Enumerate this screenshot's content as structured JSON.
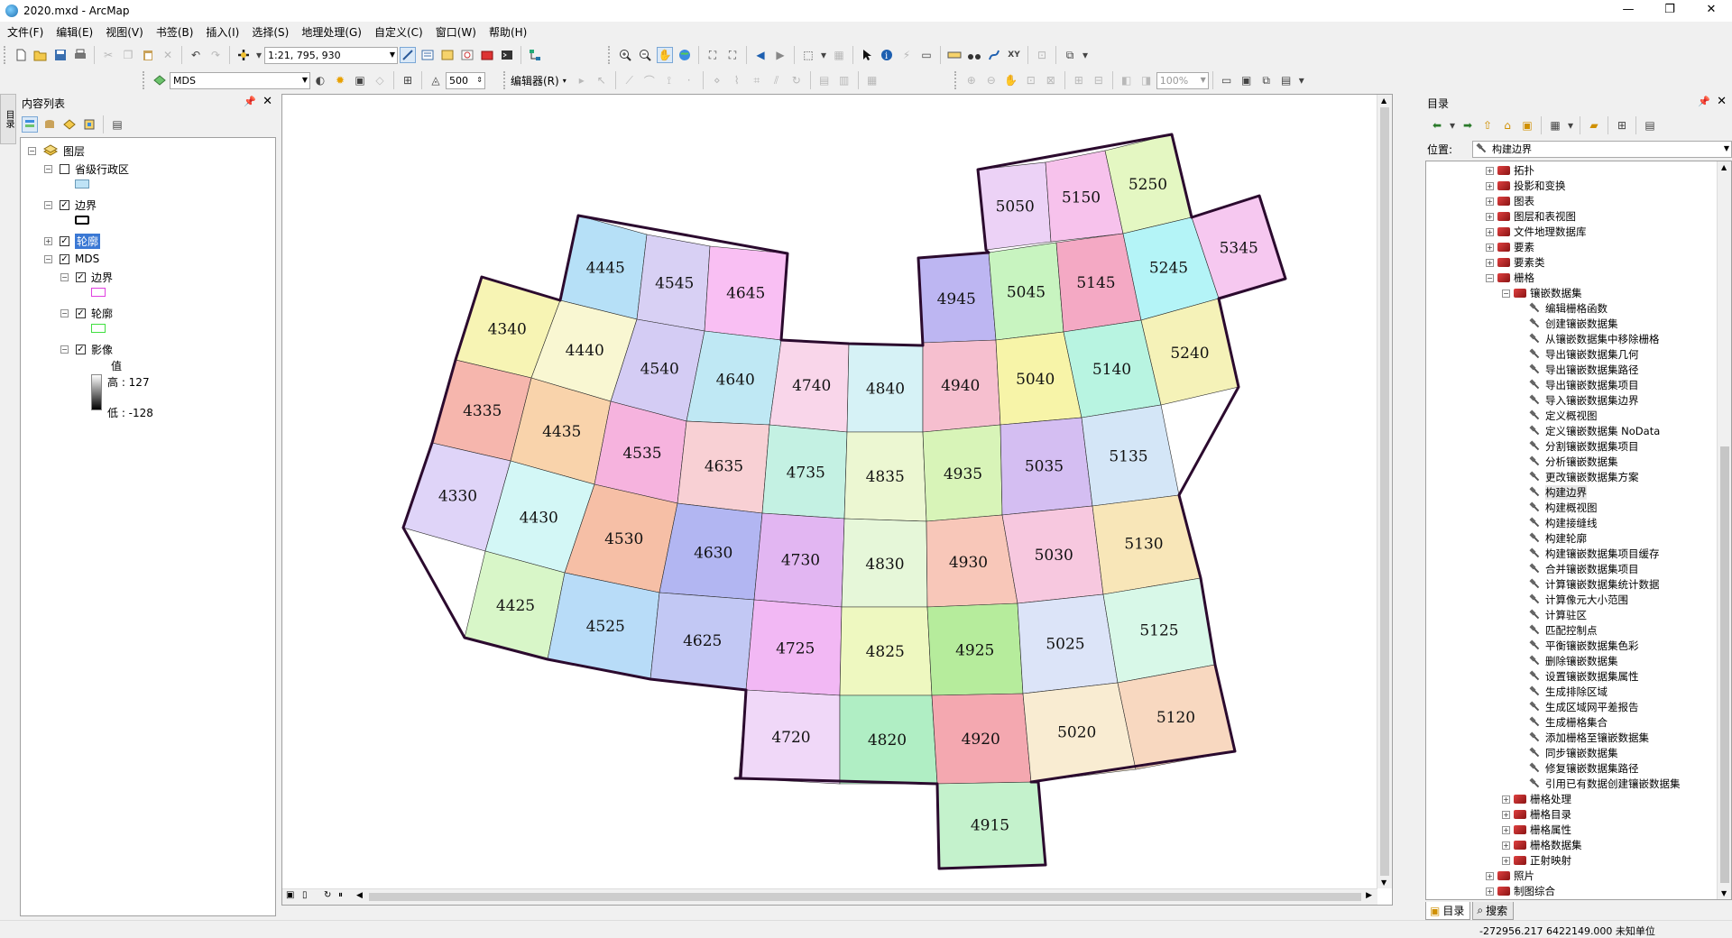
{
  "window": {
    "title": "2020.mxd - ArcMap",
    "min": "—",
    "max": "❐",
    "close": "✕"
  },
  "menu": [
    "文件(F)",
    "编辑(E)",
    "视图(V)",
    "书签(B)",
    "插入(I)",
    "选择(S)",
    "地理处理(G)",
    "自定义(C)",
    "窗口(W)",
    "帮助(H)"
  ],
  "toolbar": {
    "scale": "1:21, 795, 930",
    "layer_combo": "MDS",
    "size_value": "500",
    "editor_label": "编辑器(R)",
    "zoom_percent": "100%"
  },
  "toc": {
    "title": "内容列表",
    "side_tab": "目录",
    "root": "图层",
    "layers": [
      {
        "name": "省级行政区",
        "checked": false
      },
      {
        "name": "边界",
        "checked": true
      },
      {
        "name": "轮廓",
        "checked": true
      },
      {
        "name": "MDS",
        "checked": true
      },
      {
        "name": "边界",
        "checked": true
      },
      {
        "name": "轮廓",
        "checked": true
      },
      {
        "name": "影像",
        "checked": true
      }
    ],
    "legend_value_title": "值",
    "legend_high": "高 : 127",
    "legend_low": "低 : -128",
    "check_mark": "✓"
  },
  "map": {
    "tiles": [
      {
        "label": "5050",
        "color": "#ecd2f6"
      },
      {
        "label": "5150",
        "color": "#f7c2ec"
      },
      {
        "label": "5250",
        "color": "#e4f7c2"
      },
      {
        "label": "5345",
        "color": "#f6c8f0"
      },
      {
        "label": "4445",
        "color": "#b6e0f7"
      },
      {
        "label": "4545",
        "color": "#d8d0f4"
      },
      {
        "label": "4645",
        "color": "#f9bff3"
      },
      {
        "label": "4945",
        "color": "#bdb6f2"
      },
      {
        "label": "5045",
        "color": "#c8f4c0"
      },
      {
        "label": "5145",
        "color": "#f4a9c4"
      },
      {
        "label": "5245",
        "color": "#b4f4f7"
      },
      {
        "label": "4340",
        "color": "#f7f4b4"
      },
      {
        "label": "4440",
        "color": "#f9f7d2"
      },
      {
        "label": "4540",
        "color": "#d4ccf4"
      },
      {
        "label": "4640",
        "color": "#bfe8f4"
      },
      {
        "label": "4740",
        "color": "#f9d6ea"
      },
      {
        "label": "4840",
        "color": "#d6f2f6"
      },
      {
        "label": "4940",
        "color": "#f6bfcf"
      },
      {
        "label": "5040",
        "color": "#f7f4a8"
      },
      {
        "label": "5140",
        "color": "#b8f4e1"
      },
      {
        "label": "5240",
        "color": "#f5f2b8"
      },
      {
        "label": "4335",
        "color": "#f6b6ad"
      },
      {
        "label": "4435",
        "color": "#f9d3ab"
      },
      {
        "label": "4535",
        "color": "#f6b3de"
      },
      {
        "label": "4635",
        "color": "#f8d0d4"
      },
      {
        "label": "4735",
        "color": "#c4f1e3"
      },
      {
        "label": "4835",
        "color": "#ecf7d2"
      },
      {
        "label": "4935",
        "color": "#d8f4b8"
      },
      {
        "label": "5035",
        "color": "#d4bef2"
      },
      {
        "label": "5135",
        "color": "#d4e6f7"
      },
      {
        "label": "4330",
        "color": "#dfd4f8"
      },
      {
        "label": "4430",
        "color": "#d3f7f6"
      },
      {
        "label": "4530",
        "color": "#f6bfa6"
      },
      {
        "label": "4630",
        "color": "#b2b6f2"
      },
      {
        "label": "4730",
        "color": "#e2b6f2"
      },
      {
        "label": "4830",
        "color": "#e6f7d9"
      },
      {
        "label": "4930",
        "color": "#f8c7b9"
      },
      {
        "label": "5030",
        "color": "#f7c8df"
      },
      {
        "label": "5130",
        "color": "#f8e6b8"
      },
      {
        "label": "4425",
        "color": "#d8f6c8"
      },
      {
        "label": "4525",
        "color": "#b8dcf8"
      },
      {
        "label": "4625",
        "color": "#c2c8f4"
      },
      {
        "label": "4725",
        "color": "#f2b8f4"
      },
      {
        "label": "4825",
        "color": "#eef8c0"
      },
      {
        "label": "4925",
        "color": "#b6ec9c"
      },
      {
        "label": "5025",
        "color": "#dce4f8"
      },
      {
        "label": "5125",
        "color": "#d8f8e8"
      },
      {
        "label": "4720",
        "color": "#f0d8f8"
      },
      {
        "label": "4820",
        "color": "#b0eec4"
      },
      {
        "label": "4920",
        "color": "#f4a8b0"
      },
      {
        "label": "5020",
        "color": "#f9ecd2"
      },
      {
        "label": "5120",
        "color": "#f8d8c0"
      },
      {
        "label": "4915",
        "color": "#c4f2cc"
      }
    ]
  },
  "catalog": {
    "title": "目录",
    "location_label": "位置:",
    "location_value": "构建边界",
    "top_items": [
      "拓扑",
      "投影和变换",
      "图表",
      "图层和表视图",
      "文件地理数据库",
      "要素",
      "要素类",
      "栅格"
    ],
    "subgroup": "镶嵌数据集",
    "tools": [
      "编辑栅格函数",
      "创建镶嵌数据集",
      "从镶嵌数据集中移除栅格",
      "导出镶嵌数据集几何",
      "导出镶嵌数据集路径",
      "导出镶嵌数据集项目",
      "导入镶嵌数据集边界",
      "定义概视图",
      "定义镶嵌数据集 NoData",
      "分割镶嵌数据集项目",
      "分析镶嵌数据集",
      "更改镶嵌数据集方案",
      "构建边界",
      "构建概视图",
      "构建接缝线",
      "构建轮廓",
      "构建镶嵌数据集项目缓存",
      "合并镶嵌数据集项目",
      "计算镶嵌数据集统计数据",
      "计算像元大小范围",
      "计算驻区",
      "匹配控制点",
      "平衡镶嵌数据集色彩",
      "删除镶嵌数据集",
      "设置镶嵌数据集属性",
      "生成排除区域",
      "生成区域网平差报告",
      "生成栅格集合",
      "添加栅格至镶嵌数据集",
      "同步镶嵌数据集",
      "修复镶嵌数据集路径",
      "引用已有数据创建镶嵌数据集"
    ],
    "raster_subs": [
      "栅格处理",
      "栅格目录",
      "栅格属性",
      "栅格数据集",
      "正射映射"
    ],
    "bottom_items": [
      "照片",
      "制图综合"
    ],
    "tabs": [
      "目录",
      "搜索"
    ]
  },
  "status": {
    "coords": "-272956.217  6422149.000 未知单位"
  }
}
